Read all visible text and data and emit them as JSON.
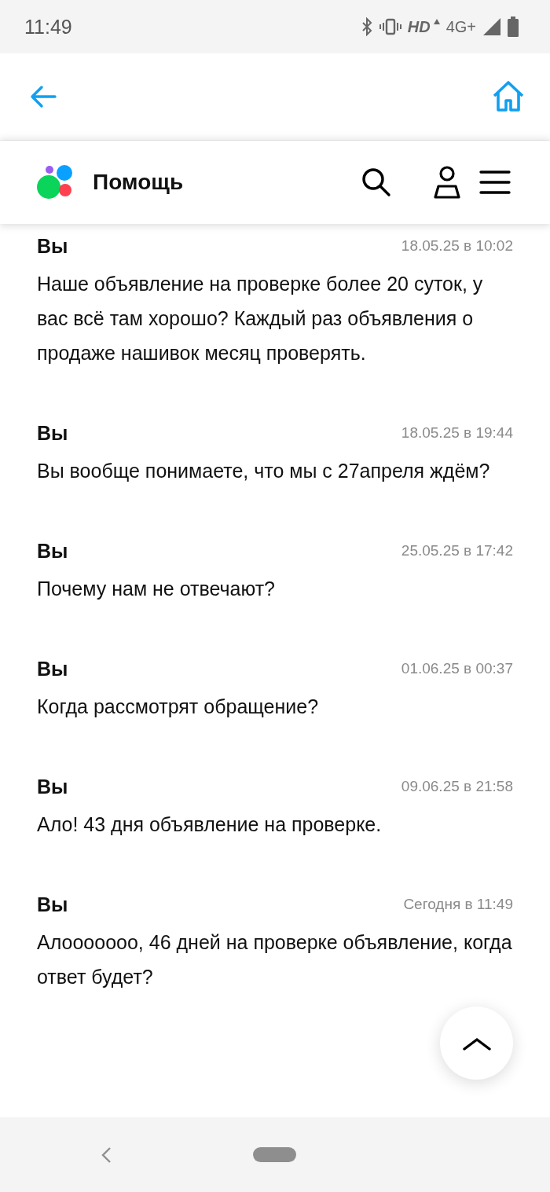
{
  "status_bar": {
    "time": "11:49",
    "hd": "HD",
    "network": "4G+"
  },
  "header": {
    "title": "Помощь"
  },
  "messages": [
    {
      "author": "Вы",
      "time": "18.05.25 в 10:02",
      "text": "Наше объявление на проверке более 20 суток, у вас всё там хорошо? Каждый раз объявления о продаже нашивок месяц проверять."
    },
    {
      "author": "Вы",
      "time": "18.05.25 в 19:44",
      "text": "Вы вообще понимаете, что мы с 27апреля ждём?"
    },
    {
      "author": "Вы",
      "time": "25.05.25 в 17:42",
      "text": "Почему нам не отвечают?"
    },
    {
      "author": "Вы",
      "time": "01.06.25 в 00:37",
      "text": "Когда рассмотрят обращение?"
    },
    {
      "author": "Вы",
      "time": "09.06.25 в 21:58",
      "text": "Ало! 43 дня объявление на проверке."
    },
    {
      "author": "Вы",
      "time": "Сегодня в 11:49",
      "text": "Алооооооо, 46 дней на проверке объявление, когда ответ будет?"
    }
  ]
}
